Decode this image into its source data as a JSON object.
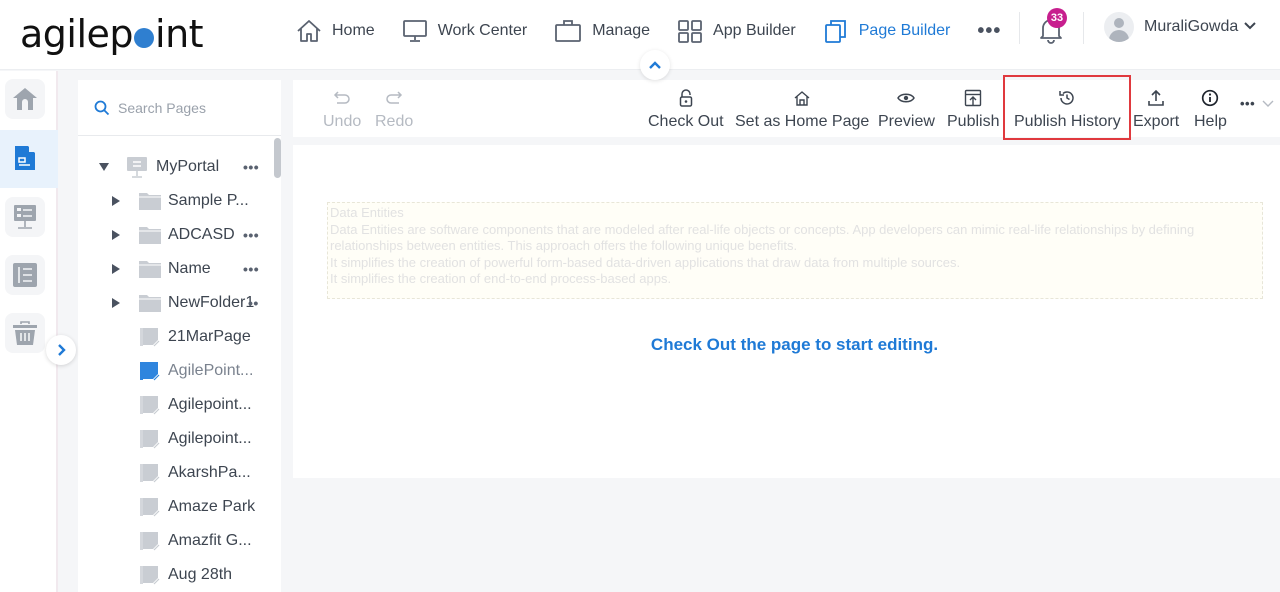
{
  "app": {
    "logo_text_a": "agilep",
    "logo_text_b": "int",
    "brand_color": "#1f7ad6"
  },
  "nav": {
    "items": [
      {
        "label": "Home",
        "icon": "home-icon",
        "active": false
      },
      {
        "label": "Work Center",
        "icon": "monitor-icon",
        "active": false
      },
      {
        "label": "Manage",
        "icon": "briefcase-icon",
        "active": false
      },
      {
        "label": "App Builder",
        "icon": "grid-icon",
        "active": false
      },
      {
        "label": "Page Builder",
        "icon": "pages-icon",
        "active": true
      }
    ],
    "more_label": "•••",
    "notification_count": "33",
    "user_name": "MuraliGowda"
  },
  "rail": {
    "items": [
      {
        "name": "home",
        "icon": "home-icon",
        "active": false
      },
      {
        "name": "pages",
        "icon": "page-icon",
        "active": true
      },
      {
        "name": "portal",
        "icon": "portal-icon",
        "active": false
      },
      {
        "name": "list",
        "icon": "list-icon",
        "active": false
      },
      {
        "name": "trash",
        "icon": "trash-icon",
        "active": false
      }
    ]
  },
  "tree": {
    "search_placeholder": "Search Pages",
    "root": {
      "label": "MyPortal",
      "more": "•••"
    },
    "folders": [
      {
        "label": "Sample P...",
        "more": ""
      },
      {
        "label": "ADCASD",
        "more": "•••"
      },
      {
        "label": "Name",
        "more": "•••"
      },
      {
        "label": "NewFolder1",
        "more": "••"
      }
    ],
    "pages": [
      {
        "label": "21MarPage",
        "selected": false
      },
      {
        "label": "AgilePoint...",
        "selected": true
      },
      {
        "label": "Agilepoint...",
        "selected": false
      },
      {
        "label": "Agilepoint...",
        "selected": false
      },
      {
        "label": "AkarshPa...",
        "selected": false
      },
      {
        "label": "Amaze Park",
        "selected": false
      },
      {
        "label": "Amazfit G...",
        "selected": false
      },
      {
        "label": "Aug 28th",
        "selected": false
      }
    ]
  },
  "toolbar": {
    "undo": "Undo",
    "redo": "Redo",
    "check_out": "Check Out",
    "set_home": "Set as Home Page",
    "preview": "Preview",
    "publish": "Publish",
    "publish_history": "Publish History",
    "export": "Export",
    "help": "Help",
    "overflow": "•••"
  },
  "canvas": {
    "entity_title": "Data Entities",
    "entity_lines": [
      "Data Entities are software components that are modeled after real-life objects or concepts. App developers can mimic real-life relationships by defining",
      "relationships between entities. This approach offers the following unique benefits.",
      "It simplifies the creation of powerful form-based data-driven applications that draw data from multiple sources.",
      "It simplifies the creation of end-to-end process-based apps."
    ],
    "message": "Check Out the page to start editing."
  }
}
